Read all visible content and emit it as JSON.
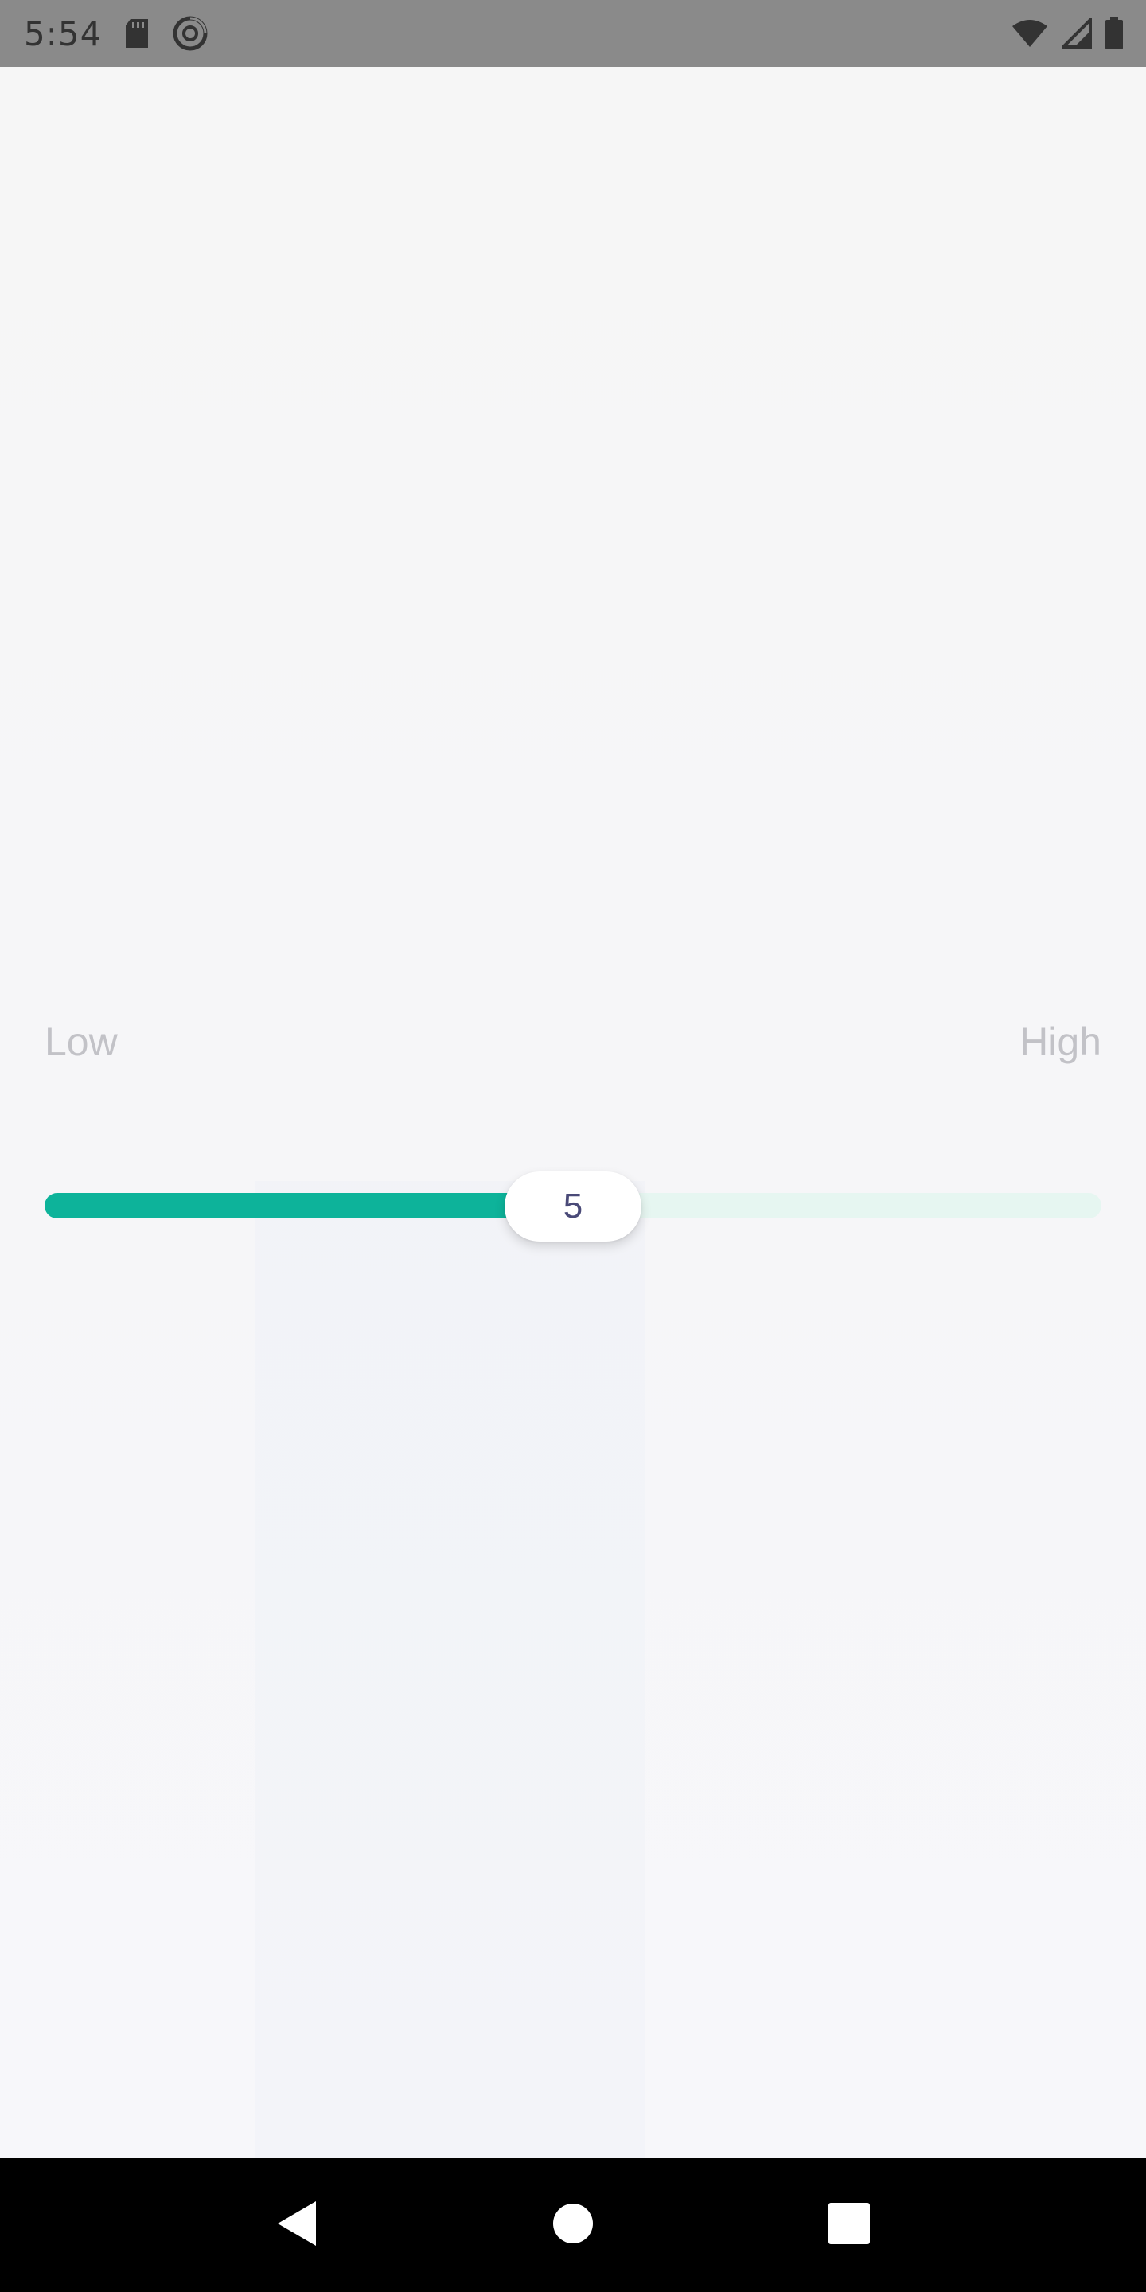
{
  "status_bar": {
    "time": "5:54",
    "icons": [
      "sd-card-icon",
      "sync-icon",
      "wifi-icon",
      "signal-icon",
      "battery-icon"
    ]
  },
  "slider": {
    "low_label": "Low",
    "high_label": "High",
    "value": "5",
    "min": 0,
    "max": 10,
    "fill_color": "#0db39a",
    "track_color": "#e6f6f1"
  },
  "nav_bar": {
    "buttons": [
      "back-icon",
      "home-icon",
      "recents-icon"
    ]
  }
}
